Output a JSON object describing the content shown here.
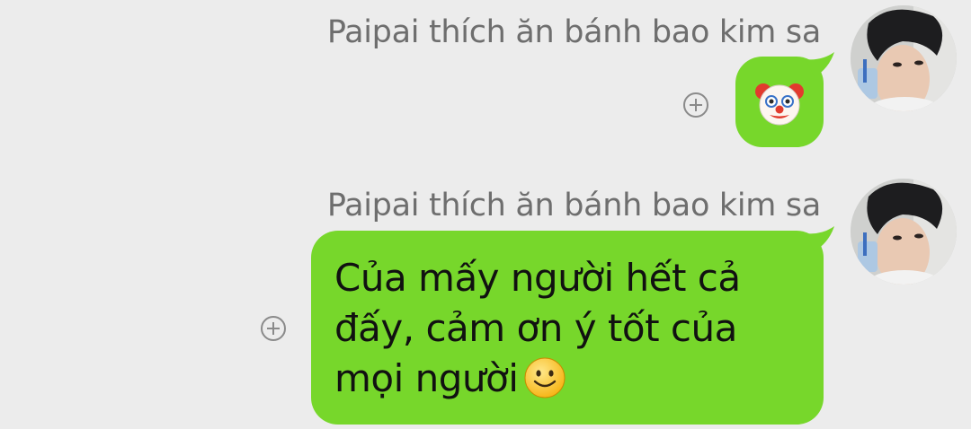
{
  "messages": [
    {
      "sender": "Paipai thích ăn bánh bao kim sa",
      "type": "emoji",
      "emoji_icon": "clown-face-emoji",
      "bubble_color": "#77d72b"
    },
    {
      "sender": "Paipai thích ăn bánh bao kim sa",
      "type": "text",
      "lines": [
        "Của mấy người hết cả",
        "đấy, cảm ơn ý tốt của",
        "mọi người"
      ],
      "trailing_emoji_icon": "slightly-smiling-face-emoji",
      "bubble_color": "#77d72b"
    }
  ],
  "colors": {
    "background": "#ececec",
    "bubble": "#77d72b",
    "sender_text": "#6e6e6e",
    "add_icon": "#8a8a8a"
  }
}
